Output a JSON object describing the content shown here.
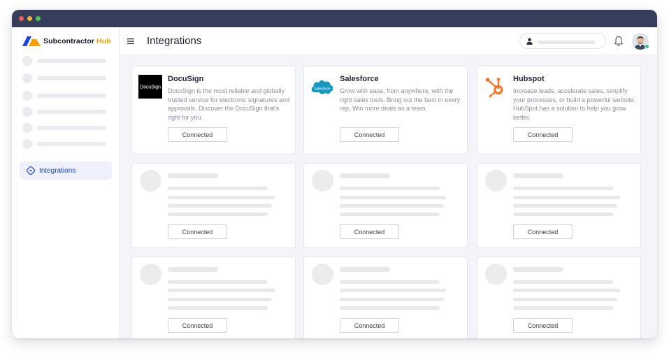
{
  "app": {
    "brand_name": "Subcontractor",
    "brand_accent": "Hub",
    "brand_colors": {
      "primary": "#1d43d8",
      "accent": "#f5a000"
    }
  },
  "sidebar": {
    "active_item": {
      "label": "Integrations",
      "icon": "integrations-icon"
    }
  },
  "header": {
    "menu_icon": "hamburger-menu-icon",
    "title": "Integrations",
    "notification_icon": "bell-icon",
    "user_status": "online"
  },
  "integrations": [
    {
      "name": "DocuSign",
      "logo_text": "DocuSign",
      "description": "DocuSign is the most reliable and globally trusted service for electronic signatures and approvals. Discover the DocuSign that's right for you.",
      "button_label": "Connected"
    },
    {
      "name": "Salesforce",
      "logo_text": "salesforce",
      "description": "Grow with ease, from anywhere, with the right sales tools. Bring out the best in every rep. Win more deals as a team.",
      "button_label": "Connected"
    },
    {
      "name": "Hubspot",
      "description": "Increase leads, accelerate sales, simplify your processes, or build a powerful website. HubSpot has a solution to help you grow better.",
      "button_label": "Connected"
    }
  ],
  "placeholder_cards": [
    {
      "button_label": "Connected"
    },
    {
      "button_label": "Connected"
    },
    {
      "button_label": "Connected"
    },
    {
      "button_label": "Connected"
    },
    {
      "button_label": "Connected"
    },
    {
      "button_label": "Connected"
    }
  ]
}
